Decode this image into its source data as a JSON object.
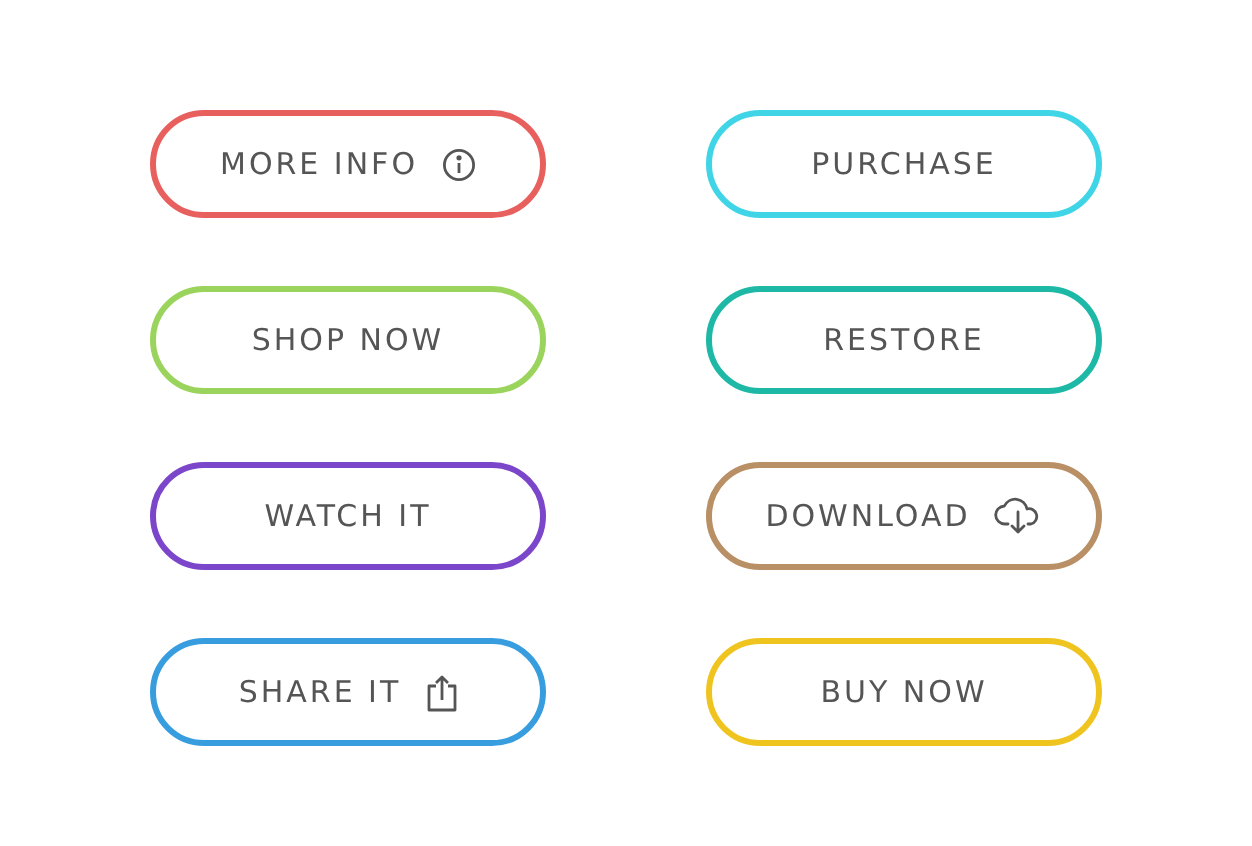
{
  "buttons": [
    {
      "label": "MORE INFO",
      "color": "#e8605e",
      "kind": "info"
    },
    {
      "label": "PURCHASE",
      "color": "#3fd5e6",
      "kind": "plain"
    },
    {
      "label": "SHOP NOW",
      "color": "#9bd45c",
      "kind": "plain"
    },
    {
      "label": "RESTORE",
      "color": "#1db8a6",
      "kind": "plain"
    },
    {
      "label": "WATCH IT",
      "color": "#7b46c9",
      "kind": "plain"
    },
    {
      "label": "DOWNLOAD",
      "color": "#b98f66",
      "kind": "download"
    },
    {
      "label": "SHARE IT",
      "color": "#389ddf",
      "kind": "share"
    },
    {
      "label": "BUY NOW",
      "color": "#f0c41f",
      "kind": "plain"
    }
  ]
}
